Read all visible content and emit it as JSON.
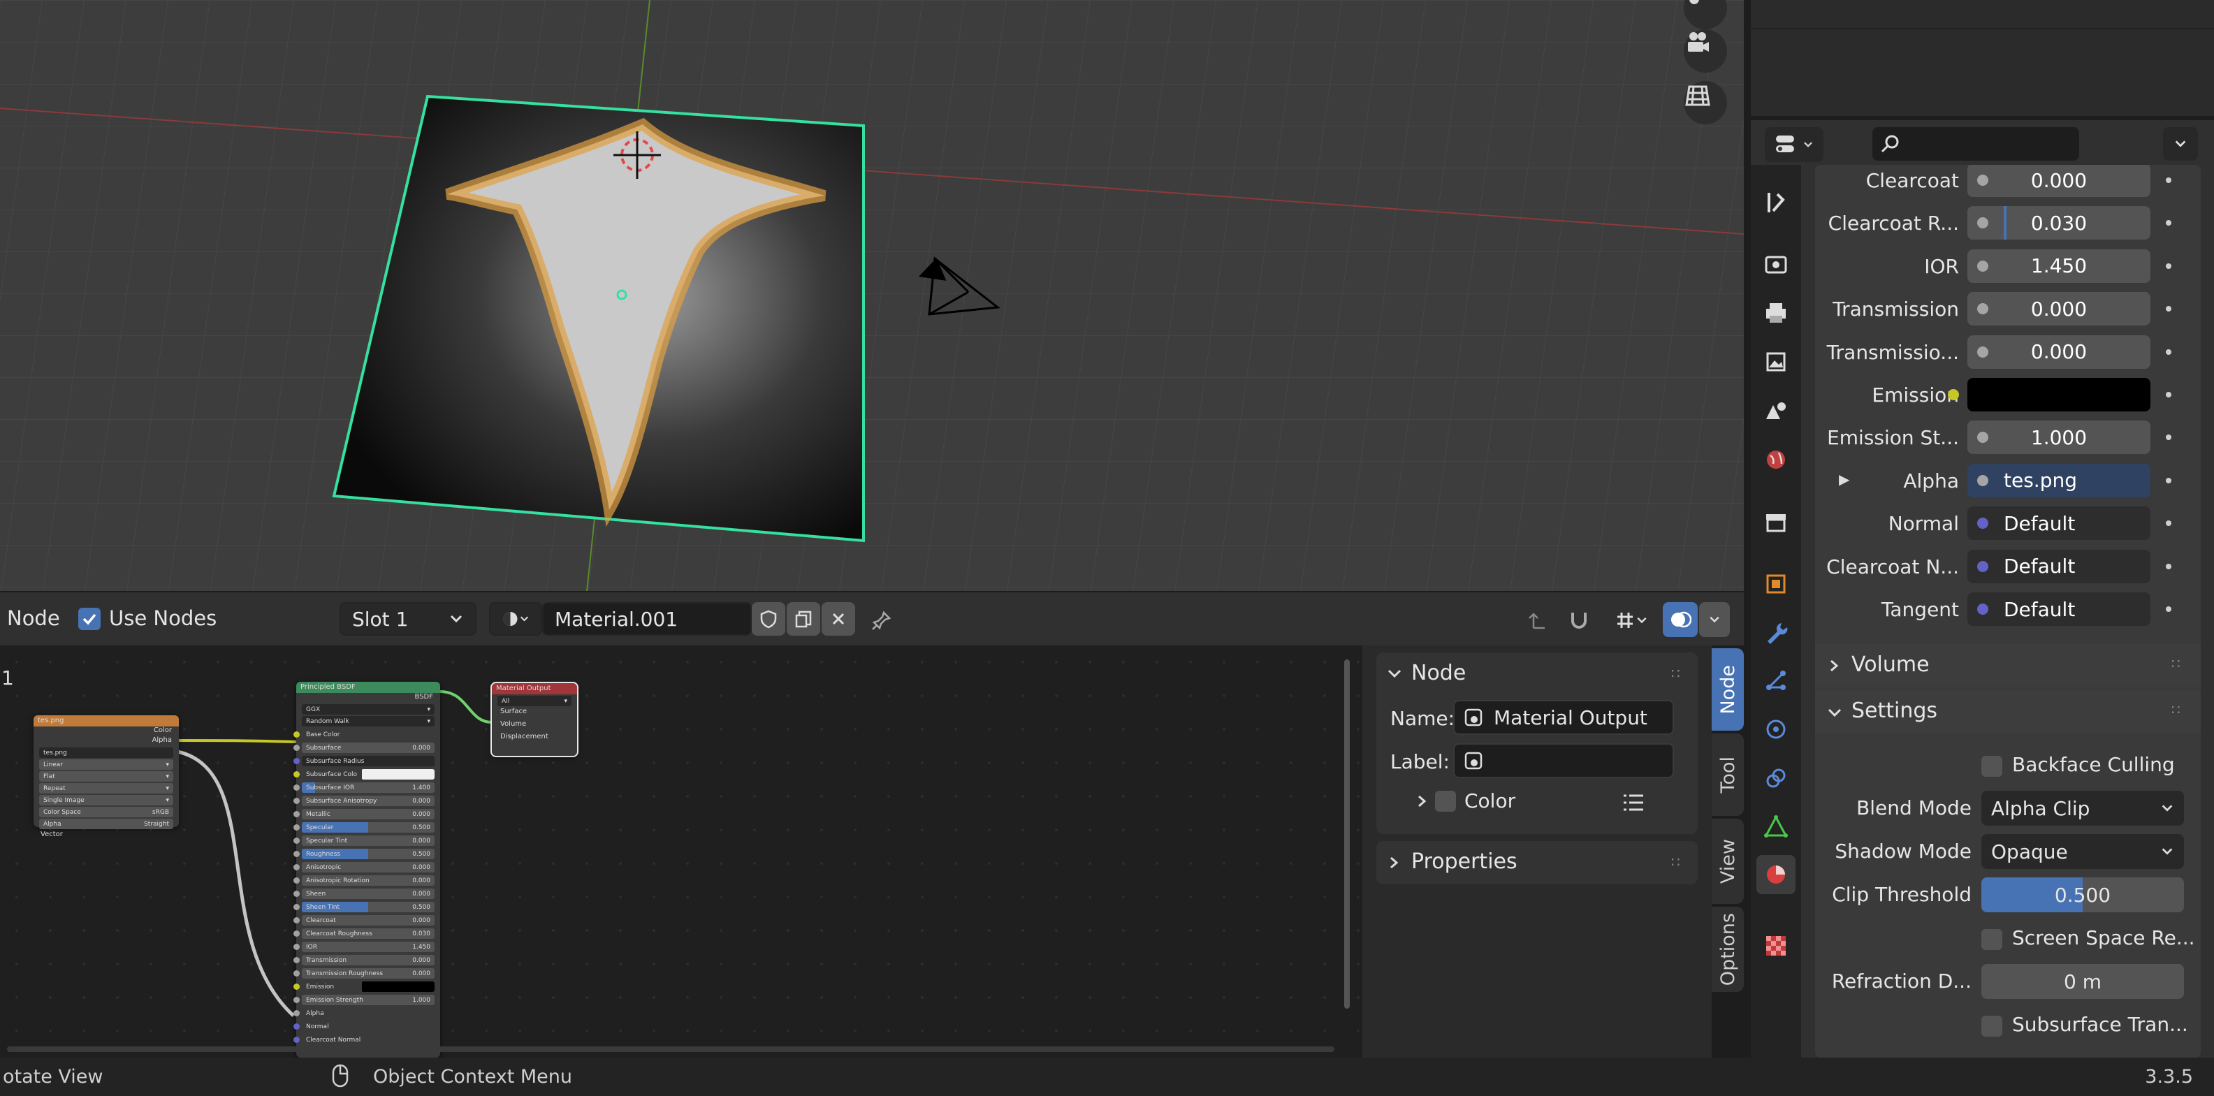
{
  "node_header": {
    "mode_label": "Node",
    "use_nodes_label": "Use Nodes",
    "slot": "Slot 1",
    "material_name": "Material.001"
  },
  "canvas": {
    "frame_number": "1"
  },
  "nodes": {
    "image_texture": {
      "title": "tes.png",
      "out_color": "Color",
      "out_alpha": "Alpha",
      "image": "tes.png",
      "interpolation": "Linear",
      "projection": "Flat",
      "extension": "Repeat",
      "source": "Single Image",
      "color_space_label": "Color Space",
      "color_space": "sRGB",
      "alpha_label": "Alpha",
      "alpha_mode": "Straight",
      "in_vector": "Vector"
    },
    "principled": {
      "title": "Principled BSDF",
      "out_bsdf": "BSDF",
      "distribution": "GGX",
      "subsurface_method": "Random Walk",
      "rows": [
        {
          "label": "Base Color",
          "value": ""
        },
        {
          "label": "Subsurface",
          "value": "0.000"
        },
        {
          "label": "Subsurface Radius",
          "value": ""
        },
        {
          "label": "Subsurface Colo",
          "value": ""
        },
        {
          "label": "Subsurface IOR",
          "value": "1.400"
        },
        {
          "label": "Subsurface Anisotropy",
          "value": "0.000"
        },
        {
          "label": "Metallic",
          "value": "0.000"
        },
        {
          "label": "Specular",
          "value": "0.500"
        },
        {
          "label": "Specular Tint",
          "value": "0.000"
        },
        {
          "label": "Roughness",
          "value": "0.500"
        },
        {
          "label": "Anisotropic",
          "value": "0.000"
        },
        {
          "label": "Anisotropic Rotation",
          "value": "0.000"
        },
        {
          "label": "Sheen",
          "value": "0.000"
        },
        {
          "label": "Sheen Tint",
          "value": "0.500"
        },
        {
          "label": "Clearcoat",
          "value": "0.000"
        },
        {
          "label": "Clearcoat Roughness",
          "value": "0.030"
        },
        {
          "label": "IOR",
          "value": "1.450"
        },
        {
          "label": "Transmission",
          "value": "0.000"
        },
        {
          "label": "Transmission Roughness",
          "value": "0.000"
        },
        {
          "label": "Emission",
          "value": ""
        },
        {
          "label": "Emission Strength",
          "value": "1.000"
        },
        {
          "label": "Alpha",
          "value": ""
        },
        {
          "label": "Normal",
          "value": ""
        },
        {
          "label": "Clearcoat Normal",
          "value": ""
        }
      ]
    },
    "material_output": {
      "title": "Material Output",
      "target": "All",
      "in_surface": "Surface",
      "in_volume": "Volume",
      "in_displacement": "Displacement"
    }
  },
  "npanel": {
    "section_title": "Node",
    "name_label": "Name:",
    "name_value": "Material Output",
    "label_label": "Label:",
    "label_value": "",
    "color_label": "Color",
    "properties_label": "Properties",
    "tabs": [
      "Node",
      "Tool",
      "View",
      "Options"
    ]
  },
  "properties": {
    "rows": [
      {
        "label": "Clearcoat",
        "value": "0.000"
      },
      {
        "label": "Clearcoat R...",
        "value": "0.030"
      },
      {
        "label": "IOR",
        "value": "1.450"
      },
      {
        "label": "Transmission",
        "value": "0.000"
      },
      {
        "label": "Transmissio...",
        "value": "0.000"
      },
      {
        "label": "Emission",
        "value": ""
      },
      {
        "label": "Emission St...",
        "value": "1.000"
      },
      {
        "label": "Alpha",
        "value": "tes.png"
      },
      {
        "label": "Normal",
        "value": "Default"
      },
      {
        "label": "Clearcoat N...",
        "value": "Default"
      },
      {
        "label": "Tangent",
        "value": "Default"
      }
    ],
    "volume_label": "Volume",
    "settings_label": "Settings",
    "backface_culling": "Backface Culling",
    "blend_mode_label": "Blend Mode",
    "blend_mode": "Alpha Clip",
    "shadow_mode_label": "Shadow Mode",
    "shadow_mode": "Opaque",
    "clip_threshold_label": "Clip Threshold",
    "clip_threshold": "0.500",
    "clip_threshold_fraction": 0.5,
    "screen_space": "Screen Space Re...",
    "refraction_depth_label": "Refraction D...",
    "refraction_depth": "0 m",
    "subsurface_translucency": "Subsurface Tran..."
  },
  "statusbar": {
    "left": "otate View",
    "middle": "Object Context Menu",
    "version": "3.3.5"
  },
  "colors": {
    "accent": "#4772b3",
    "selected_outline": "#36e0a0",
    "texture_header": "#c07a3a",
    "shader_header": "#3d8a5c",
    "output_header": "#a0353a"
  }
}
